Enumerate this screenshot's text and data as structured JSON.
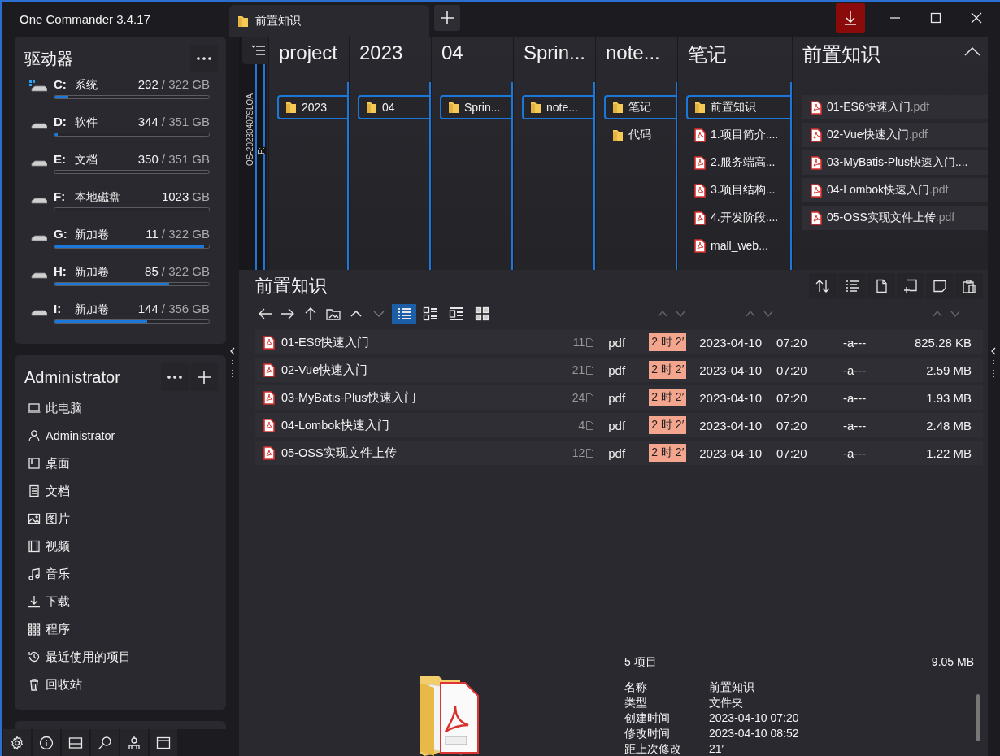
{
  "window": {
    "title": "One Commander 3.4.17"
  },
  "tabs": [
    {
      "label": "前置知识",
      "selected": true
    }
  ],
  "drives": {
    "title": "驱动器",
    "items": [
      {
        "letter": "C:",
        "label": "系统",
        "free": "292",
        "total": "/ 322 GB",
        "level": 0.09,
        "kind": "system"
      },
      {
        "letter": "D:",
        "label": "软件",
        "free": "344",
        "total": "/ 351 GB",
        "level": 0.02,
        "kind": "disk"
      },
      {
        "letter": "E:",
        "label": "文档",
        "free": "350",
        "total": "/ 351 GB",
        "level": 0.0,
        "kind": "disk"
      },
      {
        "letter": "F:",
        "label": "本地磁盘",
        "free": "1023",
        "total": "GB",
        "level": 0.0,
        "kind": "disk"
      },
      {
        "letter": "G:",
        "label": "新加卷",
        "free": "11",
        "total": "/ 322 GB",
        "level": 0.97,
        "kind": "disk"
      },
      {
        "letter": "H:",
        "label": "新加卷",
        "free": "85",
        "total": "/ 322 GB",
        "level": 0.74,
        "kind": "disk"
      },
      {
        "letter": "I:",
        "label": "新加卷",
        "free": "144",
        "total": "/ 356 GB",
        "level": 0.6,
        "kind": "disk"
      }
    ]
  },
  "places": {
    "title": "Administrator",
    "items": [
      {
        "label": "此电脑"
      },
      {
        "label": "Administrator"
      },
      {
        "label": "桌面"
      },
      {
        "label": "文档"
      },
      {
        "label": "图片"
      },
      {
        "label": "视频"
      },
      {
        "label": "音乐"
      },
      {
        "label": "下载"
      },
      {
        "label": "程序"
      },
      {
        "label": "最近使用的项目"
      },
      {
        "label": "回收站"
      }
    ]
  },
  "column_view": {
    "path_strip": [
      "OS-20230407SLOA",
      "F:"
    ],
    "columns": [
      {
        "title": "project",
        "items": [
          {
            "name": "2023",
            "kind": "folder",
            "selected": true
          }
        ]
      },
      {
        "title": "2023",
        "items": [
          {
            "name": "04",
            "kind": "folder",
            "selected": true
          }
        ]
      },
      {
        "title": "04",
        "items": [
          {
            "name": "Sprin...",
            "kind": "folder",
            "selected": true
          }
        ]
      },
      {
        "title": "Sprin...",
        "items": [
          {
            "name": "note...",
            "kind": "folder",
            "selected": true
          }
        ]
      },
      {
        "title": "note...",
        "items": [
          {
            "name": "笔记",
            "kind": "folder",
            "selected": true
          },
          {
            "name": "代码",
            "kind": "folder",
            "selected": false
          }
        ]
      },
      {
        "title": "笔记",
        "items": [
          {
            "name": "前置知识",
            "kind": "folder",
            "selected": true
          },
          {
            "name": "1.项目简介....",
            "kind": "pdf",
            "selected": false
          },
          {
            "name": "2.服务端高...",
            "kind": "pdf",
            "selected": false
          },
          {
            "name": "3.项目结构...",
            "kind": "pdf",
            "selected": false
          },
          {
            "name": "4.开发阶段....",
            "kind": "pdf",
            "selected": false
          },
          {
            "name": "mall_web...",
            "kind": "pdf",
            "selected": false
          }
        ]
      },
      {
        "title": "前置知识",
        "items": [
          {
            "name": "01-ES6快速入门",
            "ext": ".pdf",
            "kind": "pdf",
            "selected": false
          },
          {
            "name": "02-Vue快速入门",
            "ext": ".pdf",
            "kind": "pdf",
            "selected": false
          },
          {
            "name": "03-MyBatis-Plus快速入门....",
            "kind": "pdf",
            "selected": false
          },
          {
            "name": "04-Lombok快速入门",
            "ext": ".pdf",
            "kind": "pdf",
            "selected": false
          },
          {
            "name": "05-OSS实现文件上传",
            "ext": ".pdf",
            "kind": "pdf",
            "selected": false
          }
        ]
      }
    ]
  },
  "panel": {
    "title": "前置知识",
    "views": [
      {
        "selected": true
      },
      {
        "selected": false
      },
      {
        "selected": false
      },
      {
        "selected": false
      }
    ],
    "files": [
      {
        "name": "01-ES6快速入门",
        "pages": "11",
        "type": "pdf",
        "age": "2 时 2′",
        "date": "2023-04-10",
        "time": "07:20",
        "attributes": "-a---",
        "size": "825.28 KB"
      },
      {
        "name": "02-Vue快速入门",
        "pages": "21",
        "type": "pdf",
        "age": "2 时 2′",
        "date": "2023-04-10",
        "time": "07:20",
        "attributes": "-a---",
        "size": "2.59 MB"
      },
      {
        "name": "03-MyBatis-Plus快速入门",
        "pages": "24",
        "type": "pdf",
        "age": "2 时 2′",
        "date": "2023-04-10",
        "time": "07:20",
        "attributes": "-a---",
        "size": "1.93 MB"
      },
      {
        "name": "04-Lombok快速入门",
        "pages": "4",
        "type": "pdf",
        "age": "2 时 2′",
        "date": "2023-04-10",
        "time": "07:20",
        "attributes": "-a---",
        "size": "2.48 MB"
      },
      {
        "name": "05-OSS实现文件上传",
        "pages": "12",
        "type": "pdf",
        "age": "2 时 2′",
        "date": "2023-04-10",
        "time": "07:20",
        "attributes": "-a---",
        "size": "1.22 MB"
      }
    ]
  },
  "footer": {
    "count": "5 项目",
    "total_size": "9.05 MB",
    "properties": [
      {
        "label": "名称",
        "value": "前置知识"
      },
      {
        "label": "类型",
        "value": "文件夹"
      },
      {
        "label": "创建时间",
        "value": "2023-04-10  07:20"
      },
      {
        "label": "修改时间",
        "value": "2023-04-10  08:52"
      },
      {
        "label": "距上次修改",
        "value": "21′"
      }
    ]
  }
}
